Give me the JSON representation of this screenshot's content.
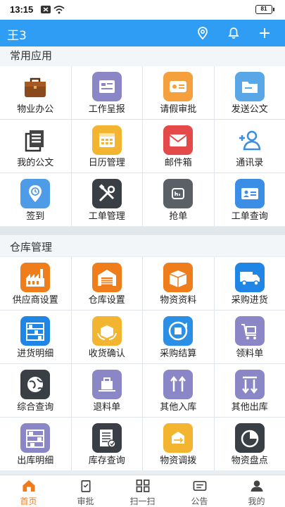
{
  "status_bar": {
    "time": "13:15",
    "battery": "81"
  },
  "header": {
    "title": "王3"
  },
  "sections": {
    "common": {
      "title": "常用应用",
      "items": [
        {
          "label": "物业办公",
          "icon": "briefcase-icon"
        },
        {
          "label": "工作呈报",
          "icon": "report-card-icon"
        },
        {
          "label": "请假审批",
          "icon": "leave-ticket-icon"
        },
        {
          "label": "发送公文",
          "icon": "folder-icon"
        },
        {
          "label": "我的公文",
          "icon": "documents-icon"
        },
        {
          "label": "日历管理",
          "icon": "calendar-icon"
        },
        {
          "label": "邮件箱",
          "icon": "mail-icon"
        },
        {
          "label": "通讯录",
          "icon": "add-contact-icon"
        },
        {
          "label": "签到",
          "icon": "location-clock-icon"
        },
        {
          "label": "工单管理",
          "icon": "tools-icon"
        },
        {
          "label": "抢单",
          "icon": "grab-order-icon"
        },
        {
          "label": "工单查询",
          "icon": "id-card-icon"
        }
      ]
    },
    "warehouse": {
      "title": "仓库管理",
      "items": [
        {
          "label": "供应商设置",
          "icon": "factory-icon"
        },
        {
          "label": "仓库设置",
          "icon": "warehouse-icon"
        },
        {
          "label": "物资资料",
          "icon": "box-icon"
        },
        {
          "label": "采购进货",
          "icon": "truck-icon"
        },
        {
          "label": "进货明细",
          "icon": "shelf-icon"
        },
        {
          "label": "收货确认",
          "icon": "receive-box-icon"
        },
        {
          "label": "采购结算",
          "icon": "cycle-box-icon"
        },
        {
          "label": "领料单",
          "icon": "cart-icon"
        },
        {
          "label": "综合查询",
          "icon": "globe-icon"
        },
        {
          "label": "退料单",
          "icon": "return-box-icon"
        },
        {
          "label": "其他入库",
          "icon": "arrows-up-icon"
        },
        {
          "label": "其他出库",
          "icon": "arrows-down-icon"
        },
        {
          "label": "出库明细",
          "icon": "outbound-shelf-icon"
        },
        {
          "label": "库存查询",
          "icon": "checklist-icon"
        },
        {
          "label": "物资调拨",
          "icon": "transfer-icon"
        },
        {
          "label": "物资盘点",
          "icon": "pie-icon"
        }
      ]
    }
  },
  "tabs": [
    {
      "label": "首页",
      "icon": "home-icon"
    },
    {
      "label": "审批",
      "icon": "approval-icon"
    },
    {
      "label": "扫一扫",
      "icon": "scan-icon"
    },
    {
      "label": "公告",
      "icon": "notice-icon"
    },
    {
      "label": "我的",
      "icon": "user-icon"
    }
  ],
  "colors": {
    "header": "#2f9df4",
    "active_tab": "#f07b1a"
  }
}
